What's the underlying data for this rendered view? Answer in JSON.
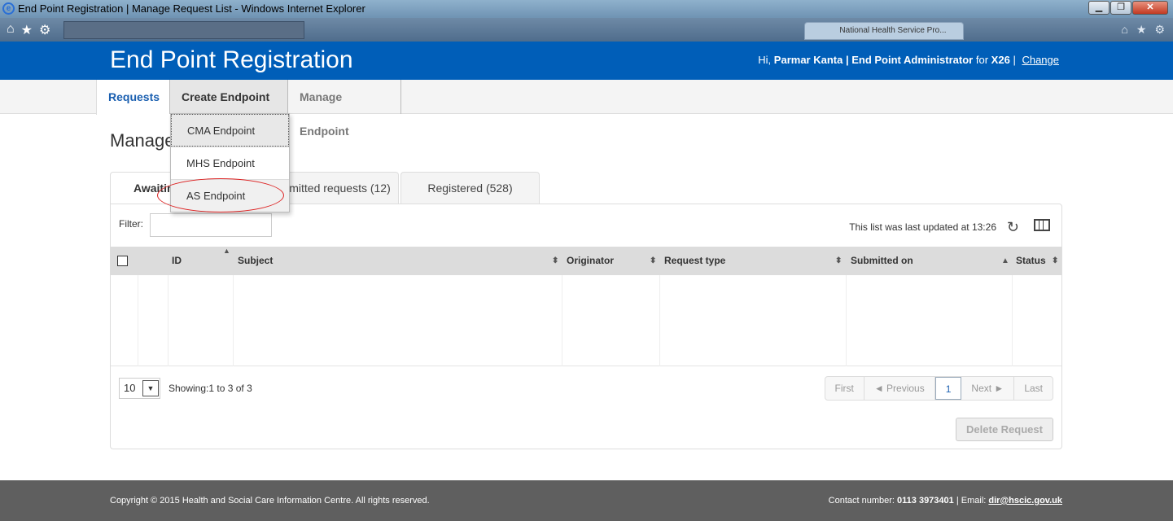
{
  "window": {
    "title": "End Point Registration | Manage Request List - Windows Internet Explorer",
    "tab_label": "National Health Service Pro..."
  },
  "header": {
    "app_title": "End Point Registration",
    "greeting": "Hi,",
    "user_name": "Parmar Kanta",
    "role": "| End Point Administrator",
    "for_label": "for",
    "org": "X26",
    "sep": "|",
    "change_link": "Change"
  },
  "nav": {
    "requests": "Requests",
    "create": "Create Endpoint",
    "manage": "Manage Endpoint"
  },
  "dropdown": {
    "items": [
      "CMA Endpoint",
      "MHS Endpoint",
      "AS Endpoint"
    ]
  },
  "page": {
    "title": "Manage"
  },
  "tabs": [
    "Awaitin",
    "mitted requests (12)",
    "Registered (528)"
  ],
  "toolbar": {
    "filter_label": "Filter:",
    "filter_value": "",
    "updated_text": "This list was last updated at 13:26"
  },
  "table": {
    "columns": [
      "ID",
      "Subject",
      "Originator",
      "Request type",
      "Submitted on",
      "Status"
    ]
  },
  "paging": {
    "page_size": "10",
    "showing": "Showing:1 to 3 of 3",
    "first": "First",
    "previous": "◄  Previous",
    "current": "1",
    "next": "Next  ►",
    "last": "Last"
  },
  "actions": {
    "delete": "Delete Request"
  },
  "footer": {
    "copyright": "Copyright © 2015 Health and Social Care Information Centre. All rights reserved.",
    "contact_prefix": "Contact number:",
    "phone": "0113 3973401",
    "email_prefix": "| Email:",
    "email": "dir@hscic.gov.uk"
  },
  "colors": {
    "brand": "#005eb8",
    "footer": "#5f5f5f",
    "annotation": "#dd2222"
  }
}
